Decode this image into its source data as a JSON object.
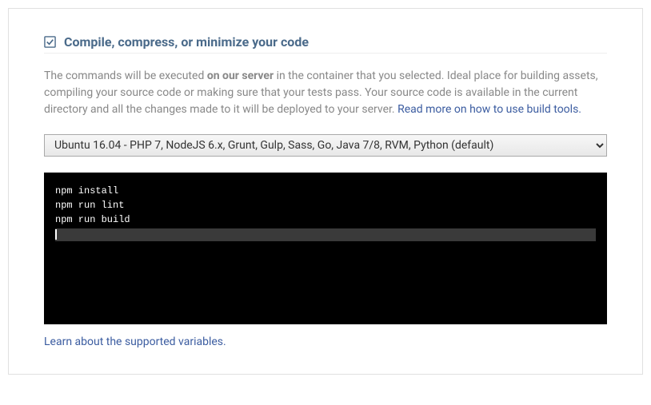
{
  "section": {
    "title": "Compile, compress, or minimize your code",
    "description_part1": "The commands will be executed ",
    "description_bold": "on our server",
    "description_part2": " in the container that you selected. Ideal place for building assets, compiling your source code or making sure that your tests pass. Your source code is available in the current directory and all the changes made to it will be deployed to your server. ",
    "description_link": "Read more on how to use build tools."
  },
  "container_select": {
    "selected": "Ubuntu 16.04 - PHP 7, NodeJS 6.x, Grunt, Gulp, Sass, Go, Java 7/8, RVM, Python (default)"
  },
  "code": {
    "line1": "npm install",
    "line2": "npm run lint",
    "line3": "npm run build"
  },
  "footer": {
    "variables_link": "Learn about the supported variables."
  }
}
